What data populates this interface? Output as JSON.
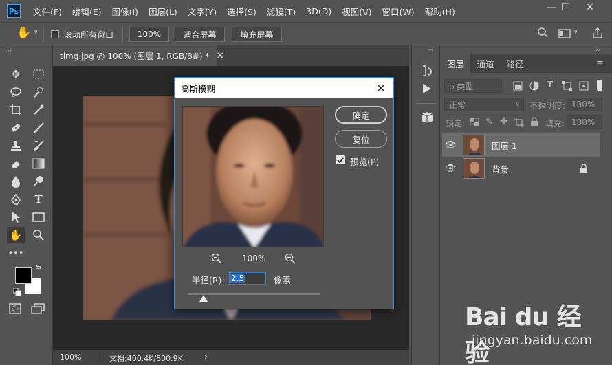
{
  "app": {
    "logo": "Ps",
    "menus": [
      "文件(F)",
      "编辑(E)",
      "图像(I)",
      "图层(L)",
      "文字(Y)",
      "选择(S)",
      "滤镜(T)",
      "3D(D)",
      "视图(V)",
      "窗口(W)",
      "帮助(H)"
    ],
    "window_controls": {
      "minimize": "—",
      "maximize": "☐",
      "close": "✕"
    }
  },
  "options": {
    "scroll_all_label": "滚动所有窗口",
    "zoom_value": "100%",
    "fit_screen_label": "适合屏幕",
    "fill_screen_label": "填充屏幕"
  },
  "document": {
    "tab_title": "timg.jpg @ 100% (图层 1, RGB/8#) *",
    "tab_close": "×",
    "status_zoom": "100%",
    "status_doc": "文档:400.4K/800.9K",
    "status_arrow": "›"
  },
  "dialog": {
    "title": "高斯模糊",
    "ok_label": "确定",
    "reset_label": "复位",
    "preview_label": "预览(P)",
    "preview_checked": true,
    "zoom_value": "100%",
    "radius_label": "半径(R):",
    "radius_value": "2.5",
    "radius_unit": "像素",
    "slider_fraction": 0.12
  },
  "panel": {
    "tabs": [
      "图层",
      "通道",
      "路径"
    ],
    "kind_placeholder": "ρ 类型",
    "blend_mode": "正常",
    "opacity_label": "不透明度:",
    "opacity_value": "100%",
    "lock_label": "锁定:",
    "fill_label": "填充:",
    "fill_value": "100%",
    "layers": [
      {
        "name": "图层 1",
        "selected": true,
        "locked": false
      },
      {
        "name": "背景",
        "selected": false,
        "locked": true
      }
    ]
  },
  "watermark": {
    "big": "Bai du 经验",
    "small": "jingyan.baidu.com"
  },
  "colors": {
    "ui_bg": "#535353",
    "dark_bg": "#282828",
    "accent": "#1e90ff"
  }
}
